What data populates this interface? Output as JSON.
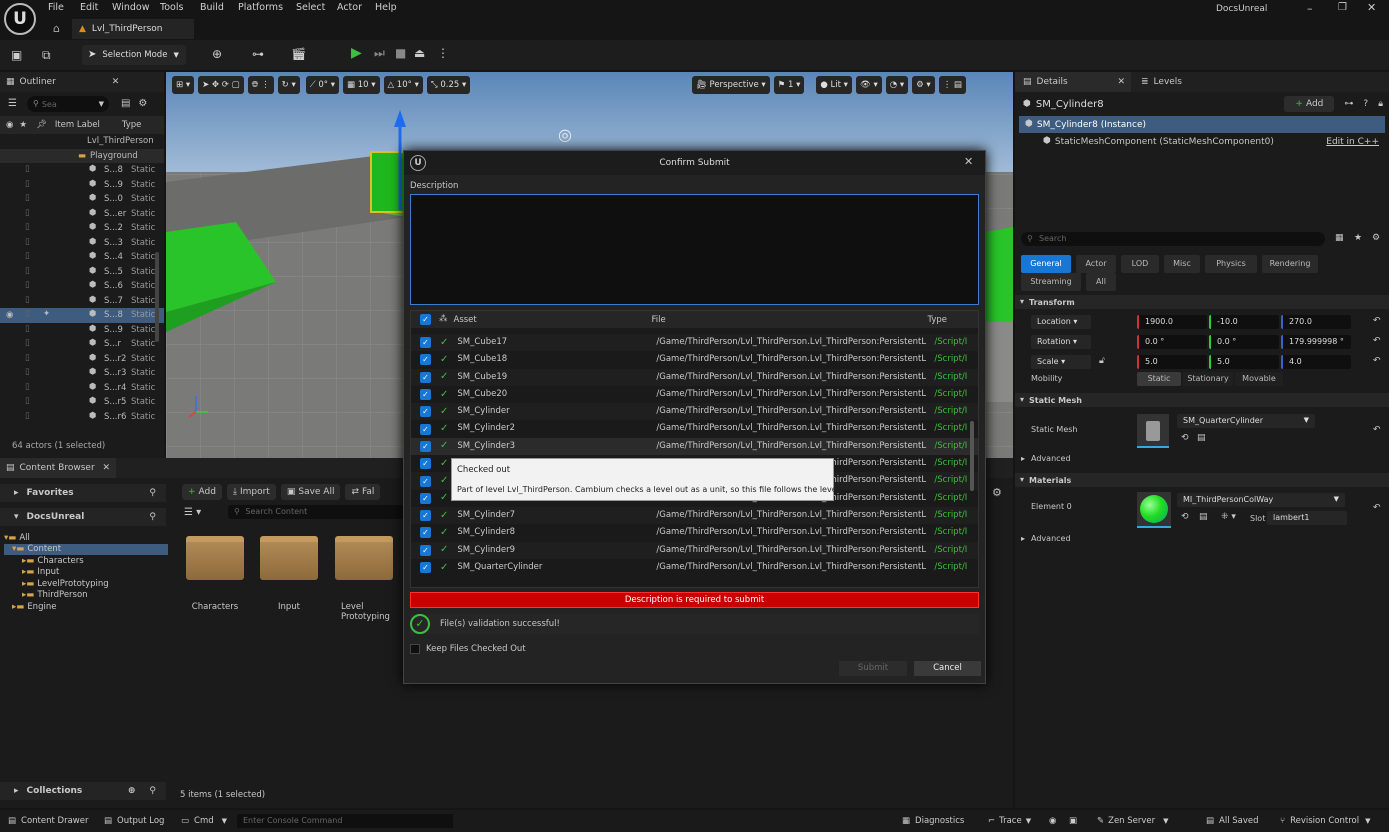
{
  "app": {
    "logo": "U",
    "level_tab": "Lvl_ThirdPerson",
    "project": "DocsUnreal"
  },
  "menu": [
    "File",
    "Edit",
    "Window",
    "Tools",
    "Build",
    "Platforms",
    "Select",
    "Actor",
    "Help"
  ],
  "toolbar": {
    "selection_mode": "Selection Mode"
  },
  "viewport": {
    "snap_angle_value": "0°",
    "grid_value": "10",
    "rot_value": "10°",
    "scale_value": "0.25",
    "perspective": "Perspective",
    "cam_speed": "1",
    "lit": "Lit"
  },
  "outliner": {
    "title": "Outliner",
    "search_placeholder": "Sea",
    "col_label": "Item Label",
    "col_type": "Type",
    "level": "Lvl_ThirdPerson",
    "folder": "Playground",
    "rows": [
      {
        "label": "S...8",
        "type": "Static"
      },
      {
        "label": "S...9",
        "type": "Static"
      },
      {
        "label": "S...0",
        "type": "Static"
      },
      {
        "label": "S...er",
        "type": "Static"
      },
      {
        "label": "S...2",
        "type": "Static"
      },
      {
        "label": "S...3",
        "type": "Static"
      },
      {
        "label": "S...4",
        "type": "Static"
      },
      {
        "label": "S...5",
        "type": "Static"
      },
      {
        "label": "S...6",
        "type": "Static"
      },
      {
        "label": "S...7",
        "type": "Static"
      },
      {
        "label": "S...8",
        "type": "Static"
      },
      {
        "label": "S...9",
        "type": "Static"
      },
      {
        "label": "S...r",
        "type": "Static"
      },
      {
        "label": "S...r2",
        "type": "Static"
      },
      {
        "label": "S...r3",
        "type": "Static"
      },
      {
        "label": "S...r4",
        "type": "Static"
      },
      {
        "label": "S...r5",
        "type": "Static"
      },
      {
        "label": "S...r6",
        "type": "Static"
      }
    ],
    "footer": "64 actors (1 selected)"
  },
  "content_browser": {
    "tab": "Content Browser",
    "favorites": "Favorites",
    "project": "DocsUnreal",
    "tree": {
      "all": "All",
      "content": "Content",
      "children": [
        "Characters",
        "Input",
        "LevelPrototyping",
        "ThirdPerson"
      ],
      "engine": "Engine"
    },
    "add": "Add",
    "import": "Import",
    "save_all": "Save All",
    "fab": "Fal",
    "search_placeholder": "Search Content",
    "folders": [
      "Characters",
      "Input",
      "Level Prototyping"
    ],
    "collections": "Collections",
    "footer": "5 items (1 selected)"
  },
  "details": {
    "tab": "Details",
    "levels_tab": "Levels",
    "actor": "SM_Cylinder8",
    "add": "Add",
    "instance": "SM_Cylinder8 (Instance)",
    "component": "StaticMeshComponent (StaticMeshComponent0)",
    "edit_cpp": "Edit in C++",
    "search_placeholder": "Search",
    "filters": [
      "General",
      "Actor",
      "LOD",
      "Misc",
      "Physics",
      "Rendering",
      "Streaming",
      "All"
    ],
    "transform": "Transform",
    "location": {
      "label": "Location",
      "x": "1900.0",
      "y": "-10.0",
      "z": "270.0"
    },
    "rotation": {
      "label": "Rotation",
      "x": "0.0 °",
      "y": "0.0 °",
      "z": "179.999998 °"
    },
    "scale": {
      "label": "Scale",
      "x": "5.0",
      "y": "5.0",
      "z": "4.0"
    },
    "mobility": {
      "label": "Mobility",
      "options": [
        "Static",
        "Stationary",
        "Movable"
      ]
    },
    "static_mesh_section": "Static Mesh",
    "static_mesh_label": "Static Mesh",
    "static_mesh_value": "SM_QuarterCylinder",
    "advanced": "Advanced",
    "materials": "Materials",
    "element0": "Element 0",
    "material_value": "MI_ThirdPersonColWay",
    "slot_label": "Slot",
    "slot_value": "lambert1",
    "advanced2": "Advanced"
  },
  "dialog": {
    "title": "Confirm Submit",
    "description_label": "Description",
    "col_asset": "Asset",
    "col_file": "File",
    "col_type": "Type",
    "rows": [
      {
        "asset": "SM_Cube17",
        "file": "/Game/ThirdPerson/Lvl_ThirdPerson.Lvl_ThirdPerson:PersistentL",
        "type": "/Script/I"
      },
      {
        "asset": "SM_Cube18",
        "file": "/Game/ThirdPerson/Lvl_ThirdPerson.Lvl_ThirdPerson:PersistentL",
        "type": "/Script/I"
      },
      {
        "asset": "SM_Cube19",
        "file": "/Game/ThirdPerson/Lvl_ThirdPerson.Lvl_ThirdPerson:PersistentL",
        "type": "/Script/I"
      },
      {
        "asset": "SM_Cube20",
        "file": "/Game/ThirdPerson/Lvl_ThirdPerson.Lvl_ThirdPerson:PersistentL",
        "type": "/Script/I"
      },
      {
        "asset": "SM_Cylinder",
        "file": "/Game/ThirdPerson/Lvl_ThirdPerson.Lvl_ThirdPerson:PersistentL",
        "type": "/Script/I"
      },
      {
        "asset": "SM_Cylinder2",
        "file": "/Game/ThirdPerson/Lvl_ThirdPerson.Lvl_ThirdPerson:PersistentL",
        "type": "/Script/I"
      },
      {
        "asset": "SM_Cylinder3",
        "file": "/Game/ThirdPerson/Lvl_ThirdPerson.Lvl_ThirdPerson:PersistentL",
        "type": "/Script/I"
      },
      {
        "asset": "",
        "file": "/Game/ThirdPerson/Lvl_ThirdPerson.Lvl_ThirdPerson:PersistentL",
        "type": "/Script/I"
      },
      {
        "asset": "",
        "file": "/Game/ThirdPerson/Lvl_ThirdPerson.Lvl_ThirdPerson:PersistentL",
        "type": "/Script/I"
      },
      {
        "asset": "",
        "file": "/Game/ThirdPerson/Lvl_ThirdPerson.Lvl_ThirdPerson:PersistentL",
        "type": "/Script/I"
      },
      {
        "asset": "SM_Cylinder7",
        "file": "/Game/ThirdPerson/Lvl_ThirdPerson.Lvl_ThirdPerson:PersistentL",
        "type": "/Script/I"
      },
      {
        "asset": "SM_Cylinder8",
        "file": "/Game/ThirdPerson/Lvl_ThirdPerson.Lvl_ThirdPerson:PersistentL",
        "type": "/Script/I"
      },
      {
        "asset": "SM_Cylinder9",
        "file": "/Game/ThirdPerson/Lvl_ThirdPerson.Lvl_ThirdPerson:PersistentL",
        "type": "/Script/I"
      },
      {
        "asset": "SM_QuarterCylinder",
        "file": "/Game/ThirdPerson/Lvl_ThirdPerson.Lvl_ThirdPerson:PersistentL",
        "type": "/Script/I"
      }
    ],
    "tooltip_title": "Checked out",
    "tooltip_body": "Part of level Lvl_ThirdPerson. Cambium checks a level out as a unit, so this file follows the level.",
    "error": "Description is required to submit",
    "validation": "File(s) validation successful!",
    "keep_checked_out": "Keep Files Checked Out",
    "submit": "Submit",
    "cancel": "Cancel"
  },
  "statusbar": {
    "content_drawer": "Content Drawer",
    "output_log": "Output Log",
    "cmd": "Cmd",
    "console_placeholder": "Enter Console Command",
    "diagnostics": "Diagnostics",
    "trace": "Trace",
    "zen": "Zen Server",
    "all_saved": "All Saved",
    "revision_control": "Revision Control"
  },
  "colors": {
    "accent": "#1677d6",
    "error": "#c80000",
    "success": "#3fbf3f",
    "link": "#6fb6ff",
    "play": "#3fbf3f"
  }
}
